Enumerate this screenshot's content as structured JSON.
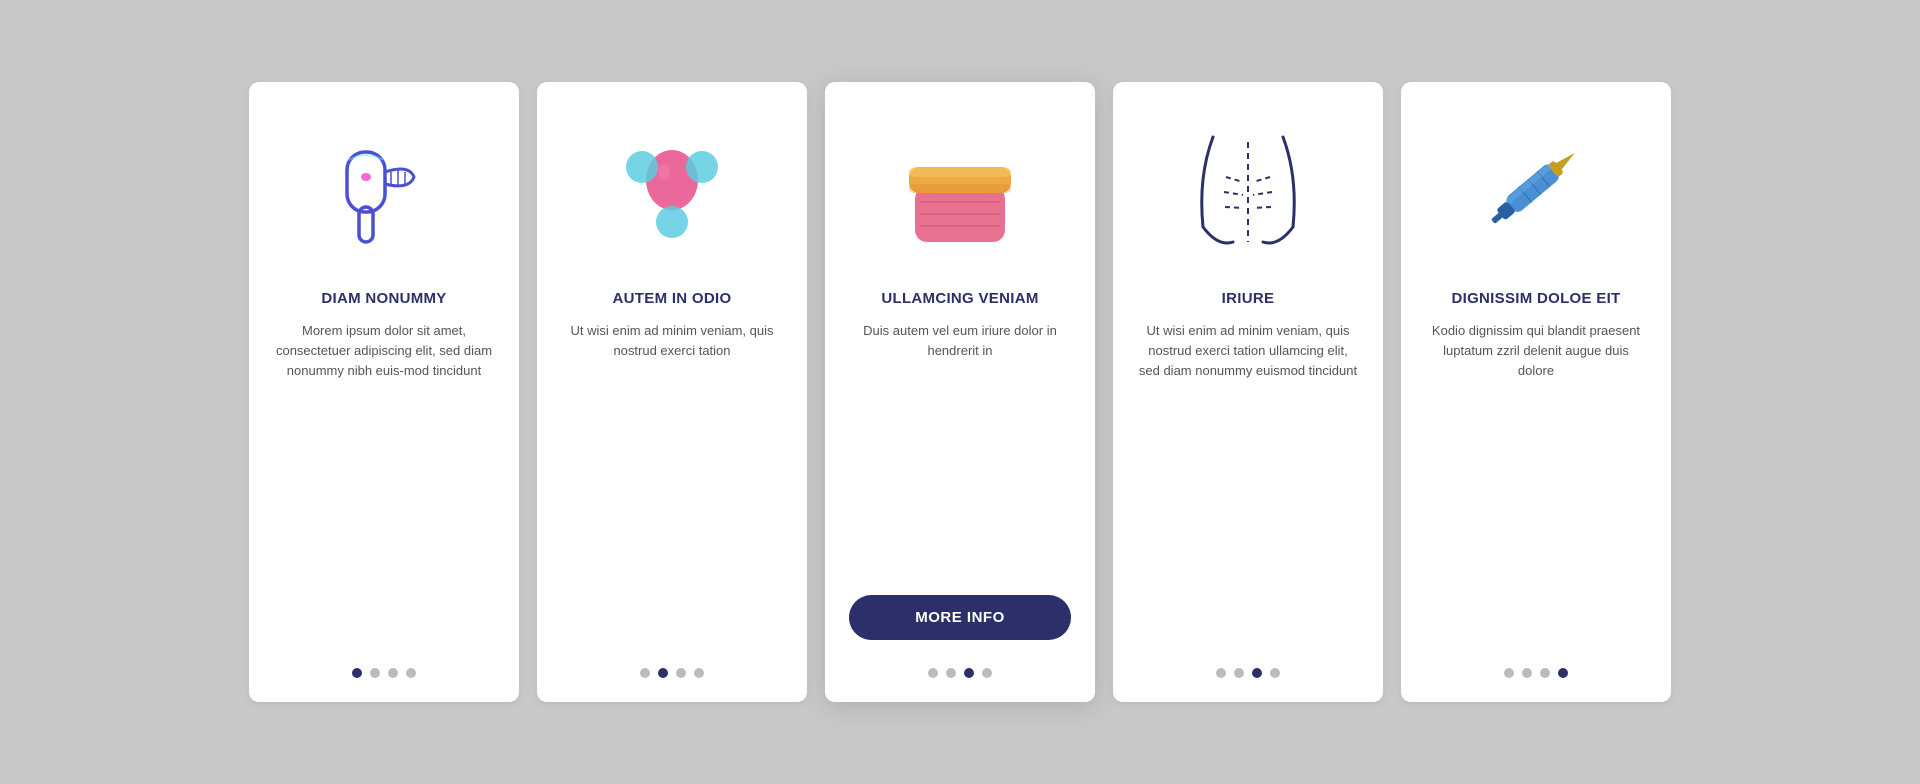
{
  "cards": [
    {
      "id": "card-1",
      "title": "DIAM NONUMMY",
      "desc": "Morem ipsum dolor sit amet, consectetuer adipiscing elit, sed diam nonummy nibh euis-mod tincidunt",
      "active_dot": 0,
      "dot_count": 4,
      "has_button": false,
      "icon": "hair-dryer"
    },
    {
      "id": "card-2",
      "title": "AUTEM IN ODIO",
      "desc": "Ut wisi enim ad minim veniam, quis nostrud exerci tation",
      "active_dot": 1,
      "dot_count": 4,
      "has_button": false,
      "icon": "massage-tool"
    },
    {
      "id": "card-3",
      "title": "ULLAMCING VENIAM",
      "desc": "Duis autem vel eum iriure dolor in hendrerit in",
      "active_dot": 2,
      "dot_count": 4,
      "has_button": true,
      "button_label": "MORE INFO",
      "icon": "cream-jar"
    },
    {
      "id": "card-4",
      "title": "IRIURE",
      "desc": "Ut wisi enim ad minim veniam, quis nostrud exerci tation ullamcing elit, sed diam nonummy euismod tincidunt",
      "active_dot": 2,
      "dot_count": 4,
      "has_button": false,
      "icon": "body-lines"
    },
    {
      "id": "card-5",
      "title": "DIGNISSIM DOLOE EIT",
      "desc": "Kodio dignissim qui blandit praesent luptatum zzril delenit augue duis dolore",
      "active_dot": 3,
      "dot_count": 4,
      "has_button": false,
      "icon": "syringe"
    }
  ]
}
